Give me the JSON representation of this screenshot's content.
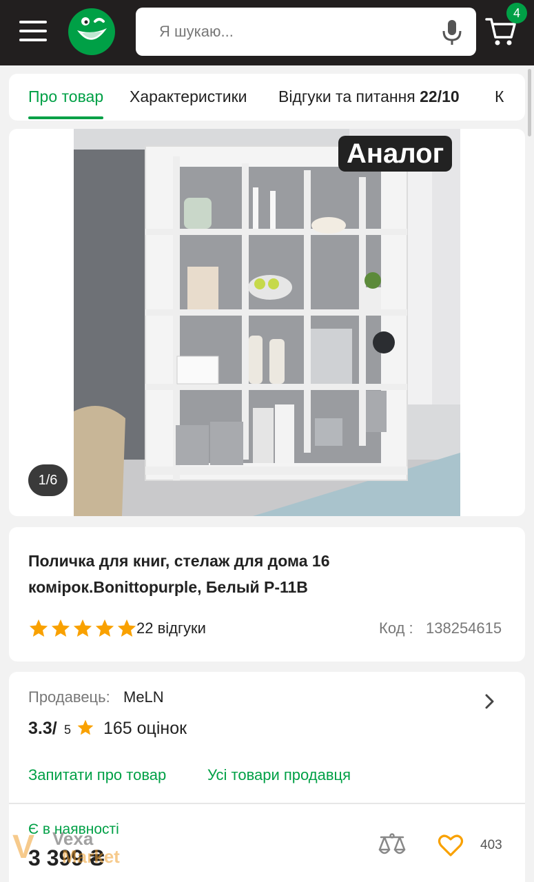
{
  "header": {
    "menu_icon": "hamburger-icon",
    "logo_icon": "smiley-logo-icon",
    "search_placeholder": "Я шукаю...",
    "mic_icon": "microphone-icon",
    "cart_icon": "cart-icon",
    "cart_count": "4",
    "colors": {
      "bar": "#221f1f",
      "accent": "#00a046"
    }
  },
  "tabs": [
    {
      "label": "Про товар",
      "active": true
    },
    {
      "label": "Характеристики",
      "active": false
    },
    {
      "label": "Відгуки та питання",
      "count": "22/10",
      "active": false
    },
    {
      "label": "К",
      "active": false
    }
  ],
  "gallery": {
    "badge": "Аналог",
    "counter": "1/6",
    "image_alt": "product-photo-white-bookshelf"
  },
  "product": {
    "title": "Поличка для книг, стелаж для дома 16 комірок.Bonittopurple, Белый Р-11В",
    "rating_stars": 5,
    "reviews": "22 відгуки",
    "code_label": "Код :",
    "code_value": "138254615"
  },
  "seller": {
    "label": "Продавець:",
    "name": "MeLN",
    "rating": "3.3/",
    "rating_max": "5",
    "rating_count": "165 оцінок",
    "ask_link": "Запитати про товар",
    "all_link": "Усі товари продавця"
  },
  "purchase": {
    "availability": "Є в наявності",
    "price": "3 399 ₴",
    "compare_icon": "scales-compare-icon",
    "wishlist_icon": "heart-icon",
    "wishlist_count": "403"
  },
  "watermark": {
    "line1": "Vexa",
    "line2": "Market"
  }
}
